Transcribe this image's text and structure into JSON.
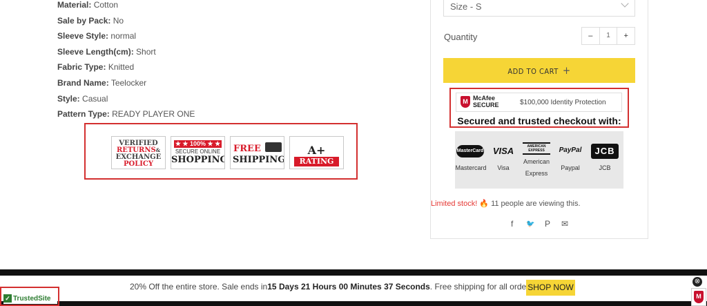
{
  "specs": [
    {
      "label": "Material:",
      "value": "Cotton"
    },
    {
      "label": "Sale by Pack:",
      "value": "No"
    },
    {
      "label": "Sleeve Style:",
      "value": "normal"
    },
    {
      "label": "Sleeve Length(cm):",
      "value": "Short"
    },
    {
      "label": "Fabric Type:",
      "value": "Knitted"
    },
    {
      "label": "Brand Name:",
      "value": "Teelocker"
    },
    {
      "label": "Style:",
      "value": "Casual"
    },
    {
      "label": "Pattern Type:",
      "value": "READY PLAYER ONE"
    }
  ],
  "badges": {
    "returns": {
      "l1": "VERIFIED",
      "l2": "RETURNS",
      "amp": "&",
      "l3": "EXCHANGE",
      "l4": "POLICY"
    },
    "secure": {
      "top": "★ ★ 100% ★ ★",
      "l1": "SECURE ONLINE",
      "l2": "SHOPPING"
    },
    "shipping": {
      "free": "FREE",
      "ship": "SHIPPING"
    },
    "rating": {
      "grade": "A+",
      "label": "RATING"
    }
  },
  "purchase": {
    "size_label": "Size -  S",
    "quantity_label": "Quantity",
    "qty_minus": "–",
    "qty_value": "1",
    "qty_plus": "+",
    "add_to_cart": "ADD TO CART",
    "add_to_cart_icon": "+"
  },
  "trust": {
    "mcafee_name": "McAfee",
    "mcafee_secure": "SECURE",
    "protection": "$100,000 Identity Protection",
    "secured_text": "Secured and trusted checkout with:"
  },
  "payments": [
    {
      "logo": "MasterCard",
      "label": "Mastercard"
    },
    {
      "logo": "VISA",
      "label": "Visa"
    },
    {
      "logo": "AMERICAN EXPRESS",
      "label": "American Express"
    },
    {
      "logo": "PayPal",
      "label": "Paypal"
    },
    {
      "logo": "JCB",
      "label": "JCB"
    }
  ],
  "stock": {
    "limited": "Limited stock!",
    "fire_icon": "🔥",
    "viewing": "11 people are viewing this."
  },
  "social": {
    "facebook": "f",
    "twitter": "🐦",
    "pinterest": "P",
    "email": "✉"
  },
  "promo": {
    "prefix": "20% Off the entire store. Sale ends in",
    "days": "15",
    "days_label": "Days",
    "hours": "21",
    "hours_label": "Hours",
    "minutes": "00",
    "minutes_label": "Minutes",
    "seconds": "37",
    "seconds_label": "Seconds",
    "suffix": ". Free shipping for all orders.",
    "shop_now": "SHOP NOW",
    "close": "⊗"
  },
  "trusted_site": {
    "check": "✓",
    "text": "TrustedSite"
  },
  "colors": {
    "accent_yellow": "#f6d536",
    "brand_red": "#d81b2a",
    "highlight_box": "#d32f2f"
  }
}
